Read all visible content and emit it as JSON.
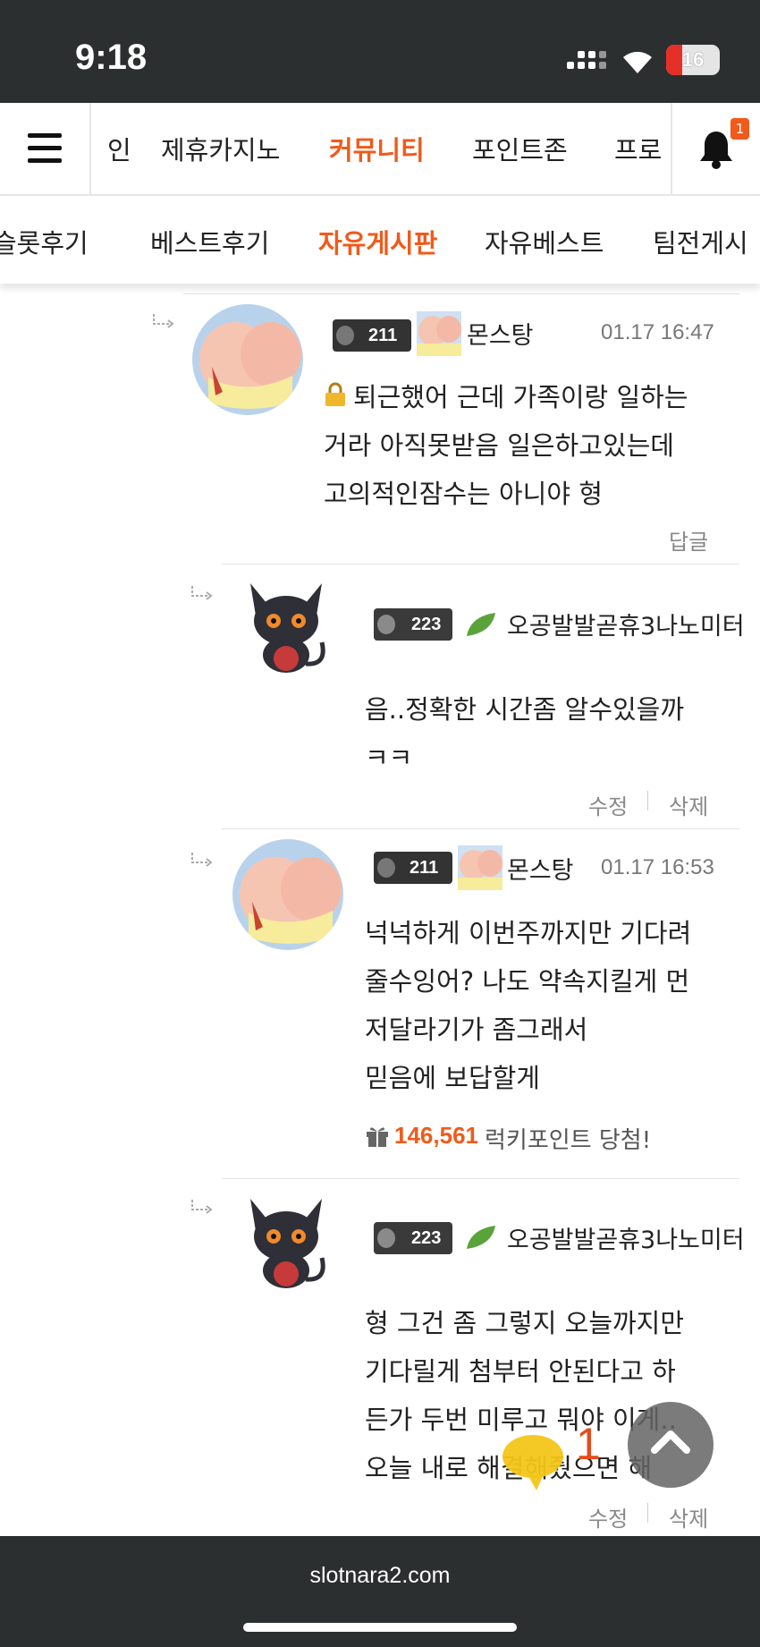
{
  "status": {
    "time": "9:18",
    "battery": "16"
  },
  "nav": {
    "items": [
      "인",
      "제휴카지노",
      "커뮤니티",
      "포인트존",
      "프로"
    ],
    "active": "커뮤니티",
    "notification_count": "1"
  },
  "subnav": {
    "items": [
      "슬롯후기",
      "베스트후기",
      "자유게시판",
      "자유베스트",
      "팀전게시"
    ],
    "active": "자유게시판"
  },
  "comments": [
    {
      "level": "211",
      "author": "몬스탕",
      "date": "01.17 16:47",
      "lines": [
        "퇴근했어 근데 가족이랑 일하는",
        "거라 아직못받음 일은하고있는데",
        "고의적인잠수는 아니야  형"
      ],
      "actions": [
        "답글"
      ]
    },
    {
      "level": "223",
      "author": "오공발발곧휴3나노미터",
      "lines": [
        "음..정확한 시간좀 알수있을까",
        "ㅋㅋ"
      ],
      "actions": [
        "수정",
        "삭제"
      ]
    },
    {
      "level": "211",
      "author": "몬스탕",
      "date": "01.17 16:53",
      "lines": [
        "넉넉하게 이번주까지만 기다려",
        "줄수잉어? 나도 약속지킬게 먼",
        "저달라기가 좀그래서",
        "믿음에 보답할게"
      ],
      "lucky_amount": "146,561",
      "lucky_text": "럭키포인트 당첨!"
    },
    {
      "level": "223",
      "author": "오공발발곧휴3나노미터",
      "lines": [
        "형 그건 좀 그렇지 오늘까지만",
        "기다릴게 첨부터 안된다고 하",
        "든가 두번 미루고 뭐야 이게..",
        "오늘 내로 해결해줬으면 해"
      ],
      "actions": [
        "수정",
        "삭제"
      ]
    }
  ],
  "floating": {
    "chat_count": "1"
  },
  "footer": {
    "domain": "slotnara2.com"
  }
}
